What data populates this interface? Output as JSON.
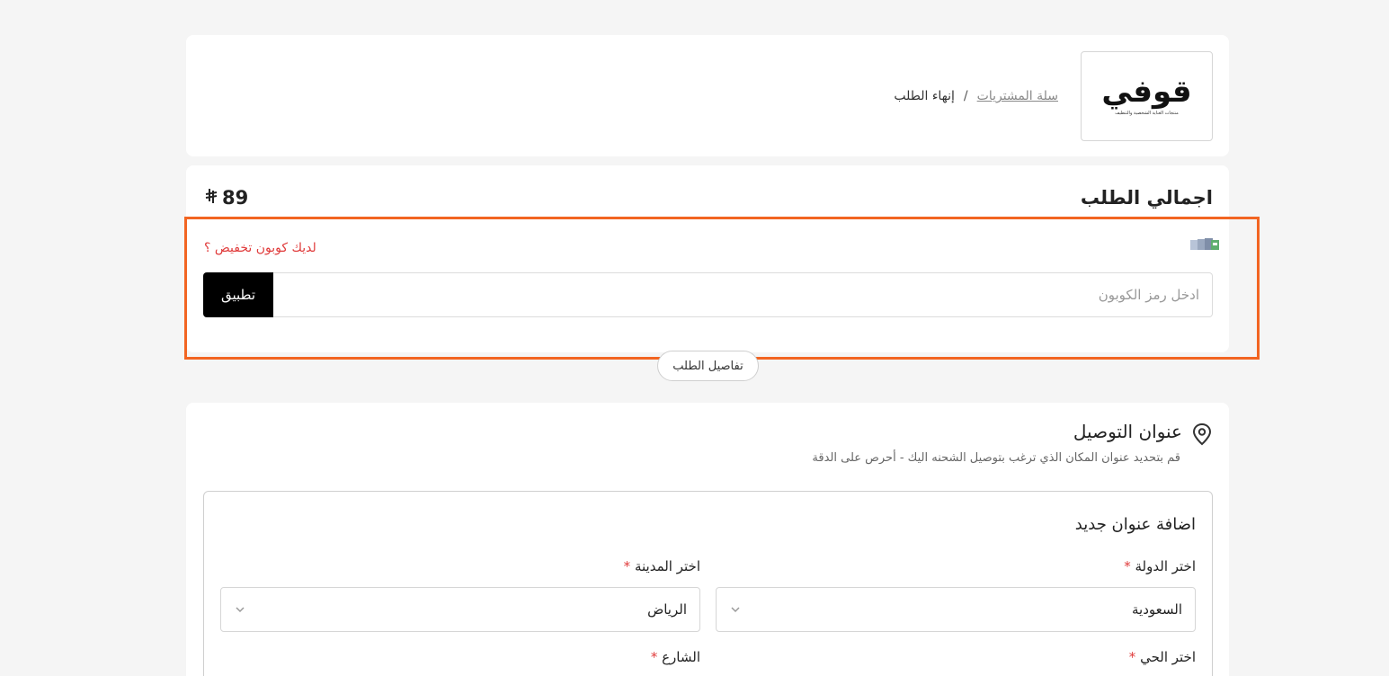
{
  "header": {
    "logo": {
      "wordmark": "قوفي",
      "tagline": "منتجات العناية الشخصية والتنظيف"
    },
    "breadcrumb": {
      "link_label": "سلة المشتريات",
      "separator": "/",
      "current_label": "إنهاء الطلب"
    }
  },
  "summary": {
    "title": "اجمالي الطلب",
    "total_value": "89",
    "currency_symbol": "⃁",
    "coupon": {
      "question": "لديك كوبون تخفيض ؟",
      "input_value": "",
      "input_placeholder": "ادخل رمز الكوبون",
      "apply_label": "تطبيق"
    },
    "details_button_label": "تفاصيل الطلب"
  },
  "address": {
    "title": "عنوان التوصيل",
    "subtitle": "قم بتحديد عنوان المكان الذي ترغب بتوصيل الشحنه اليك - أحرص على الدقة",
    "new_address": {
      "title": "اضافة عنوان جديد",
      "country": {
        "label": "اختر الدولة",
        "required_mark": "*",
        "value": "السعودية"
      },
      "city": {
        "label": "اختر المدينة",
        "required_mark": "*",
        "value": "الرياض"
      },
      "district": {
        "label": "اختر الحي",
        "required_mark": "*"
      },
      "street": {
        "label": "الشارع",
        "required_mark": "*"
      }
    }
  },
  "icons": {
    "coupon": "coupon-cards-icon",
    "location": "location-pin-icon",
    "chevron": "chevron-down-icon"
  },
  "colors": {
    "accent_highlight": "#f26522",
    "required": "#e03b3b",
    "apply_button": "#000000"
  }
}
